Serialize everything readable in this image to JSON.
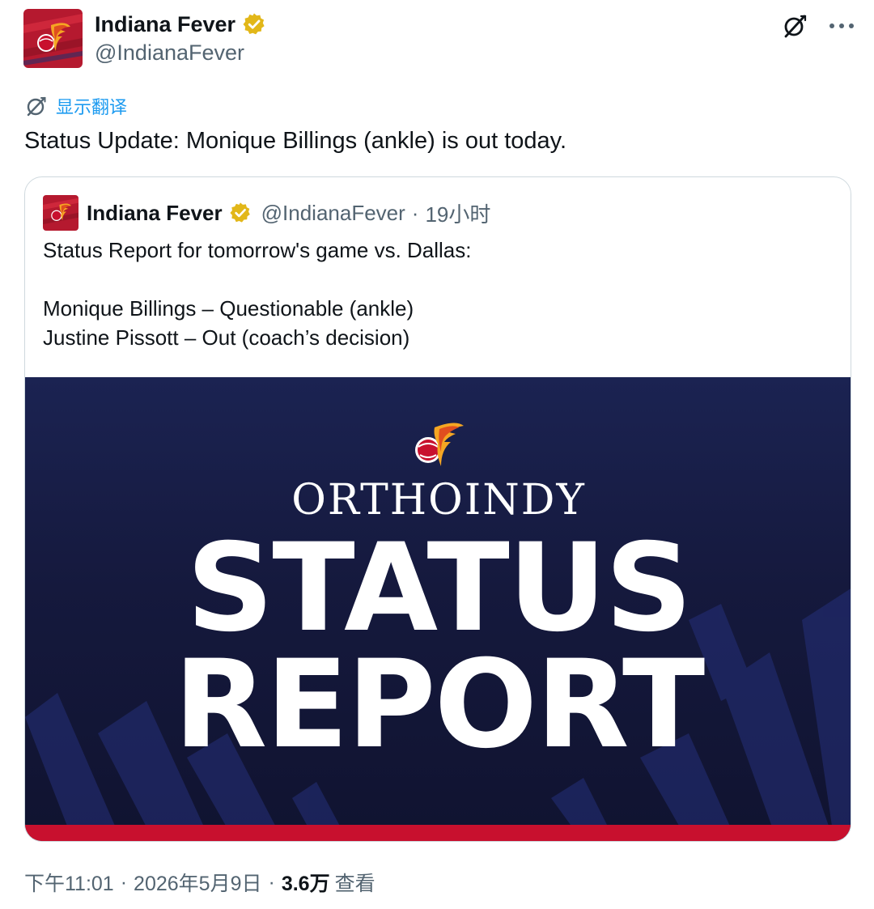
{
  "author": {
    "name": "Indiana Fever",
    "handle": "@IndianaFever",
    "verified": true
  },
  "translate": {
    "label": "显示翻译"
  },
  "tweet": {
    "text": "Status Update: Monique Billings (ankle) is out today."
  },
  "quoted": {
    "name": "Indiana Fever",
    "handle": "@IndianaFever",
    "separator": "·",
    "time": "19小时",
    "lines": [
      "Status Report for tomorrow's game vs. Dallas:",
      "",
      "Monique Billings – Questionable (ankle)",
      "Justine Pissott – Out (coach’s decision)"
    ],
    "media": {
      "sponsor": "ORTHOINDY",
      "headline_1": "STATUS",
      "headline_2": "REPORT"
    }
  },
  "meta": {
    "time": "下午11:01",
    "separator": "·",
    "date": "2026年5月9日",
    "views_count": "3.6万",
    "views_label": "查看"
  },
  "colors": {
    "accent": "#1d9bf0",
    "verified_gold": "#e2b719",
    "fever_red": "#c8102e",
    "fever_navy": "#1b2352"
  },
  "icons": {
    "grok": "grok-icon",
    "more": "more-icon",
    "translate": "translate-icon",
    "verified": "verified-badge-icon"
  }
}
